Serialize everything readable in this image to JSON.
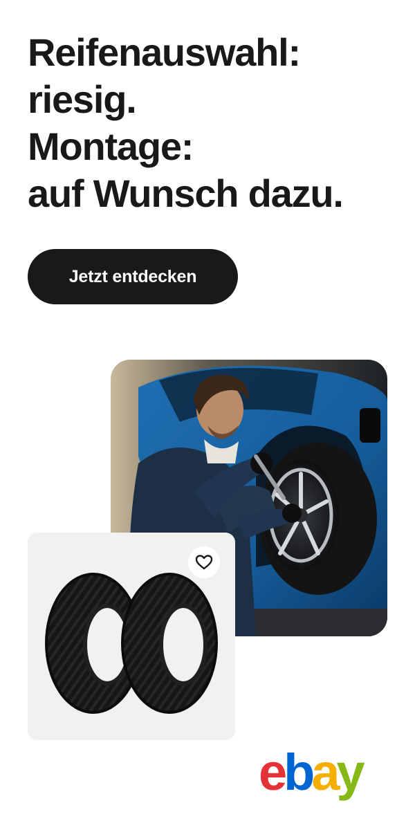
{
  "headline": {
    "line1": "Reifenauswahl:",
    "line2": "riesig.",
    "line3": "Montage:",
    "line4": "auf Wunsch dazu."
  },
  "cta": {
    "label": "Jetzt entdecken"
  },
  "photo": {
    "subject": "mechanic-mounting-tire-icon"
  },
  "product_card": {
    "image": "tires-icon",
    "favorite_icon": "heart-icon"
  },
  "logo": {
    "text": "ebay",
    "colors": {
      "e": "#E53238",
      "b": "#0064D2",
      "a": "#F5AF02",
      "y": "#86B817"
    }
  },
  "colors": {
    "text": "#191919",
    "button_bg": "#191919",
    "button_text": "#FFFFFF",
    "card_bg": "#F1F1F1"
  }
}
